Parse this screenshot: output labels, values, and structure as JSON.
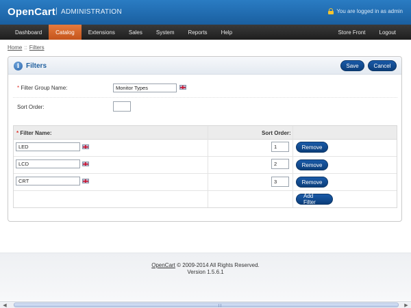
{
  "header": {
    "logo": "OpenCart",
    "separator": "|",
    "subtitle": "ADMINISTRATION",
    "login_text": "You are logged in as admin",
    "lock_icon": "lock-icon"
  },
  "menu": {
    "items": [
      {
        "label": "Dashboard"
      },
      {
        "label": "Catalog",
        "active": true
      },
      {
        "label": "Extensions"
      },
      {
        "label": "Sales"
      },
      {
        "label": "System"
      },
      {
        "label": "Reports"
      },
      {
        "label": "Help"
      }
    ],
    "right_items": [
      {
        "label": "Store Front"
      },
      {
        "label": "Logout"
      }
    ],
    "active_color": "#d9652b"
  },
  "breadcrumb": {
    "items": [
      "Home",
      "Filters"
    ],
    "separator": "::"
  },
  "box": {
    "title": "Filters",
    "info_icon": "info-icon",
    "save_label": "Save",
    "cancel_label": "Cancel"
  },
  "form": {
    "group_name_label": "Filter Group Name:",
    "group_name_required": "*",
    "group_name_value": "Monitor Types",
    "sort_order_label": "Sort Order:",
    "sort_order_value": ""
  },
  "filters_table": {
    "headers": {
      "required_mark": "*",
      "filter_name": "Filter Name:",
      "sort_order": "Sort Order:"
    },
    "rows": [
      {
        "name": "LED",
        "sort_order": "1",
        "remove_label": "Remove"
      },
      {
        "name": "LCD",
        "sort_order": "2",
        "remove_label": "Remove"
      },
      {
        "name": "CRT",
        "sort_order": "3",
        "remove_label": "Remove"
      }
    ],
    "add_filter_label": "Add Filter"
  },
  "footer": {
    "link_text": "OpenCart",
    "copyright": "© 2009-2014 All Rights Reserved.",
    "version": "Version 1.5.6.1"
  },
  "colors": {
    "header_blue": "#1f6bb3",
    "button_blue": "#124c92",
    "menu_dark": "#2a2a2a",
    "required_red": "#e0312a"
  }
}
